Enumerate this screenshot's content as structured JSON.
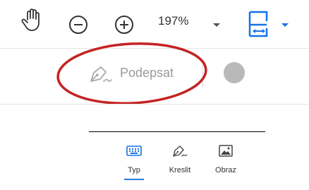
{
  "toolbar": {
    "zoom_value": "197%",
    "icons": [
      "hand-icon",
      "zoom-out-icon",
      "zoom-in-icon",
      "chevron-down-icon",
      "fit-page-icon"
    ]
  },
  "signbar": {
    "sign_label": "Podepsat",
    "dot_color": "#b9b9b9",
    "highlight_color": "#c42323"
  },
  "signature_tabs": [
    {
      "label": "Typ",
      "icon": "keyboard-icon",
      "active": true
    },
    {
      "label": "Kreslit",
      "icon": "pen-nib-icon",
      "active": false
    },
    {
      "label": "Obraz",
      "icon": "image-icon",
      "active": false
    }
  ],
  "colors": {
    "accent": "#2d7be5",
    "icon_blue": "#1473e6",
    "icon_dark": "#333333"
  }
}
